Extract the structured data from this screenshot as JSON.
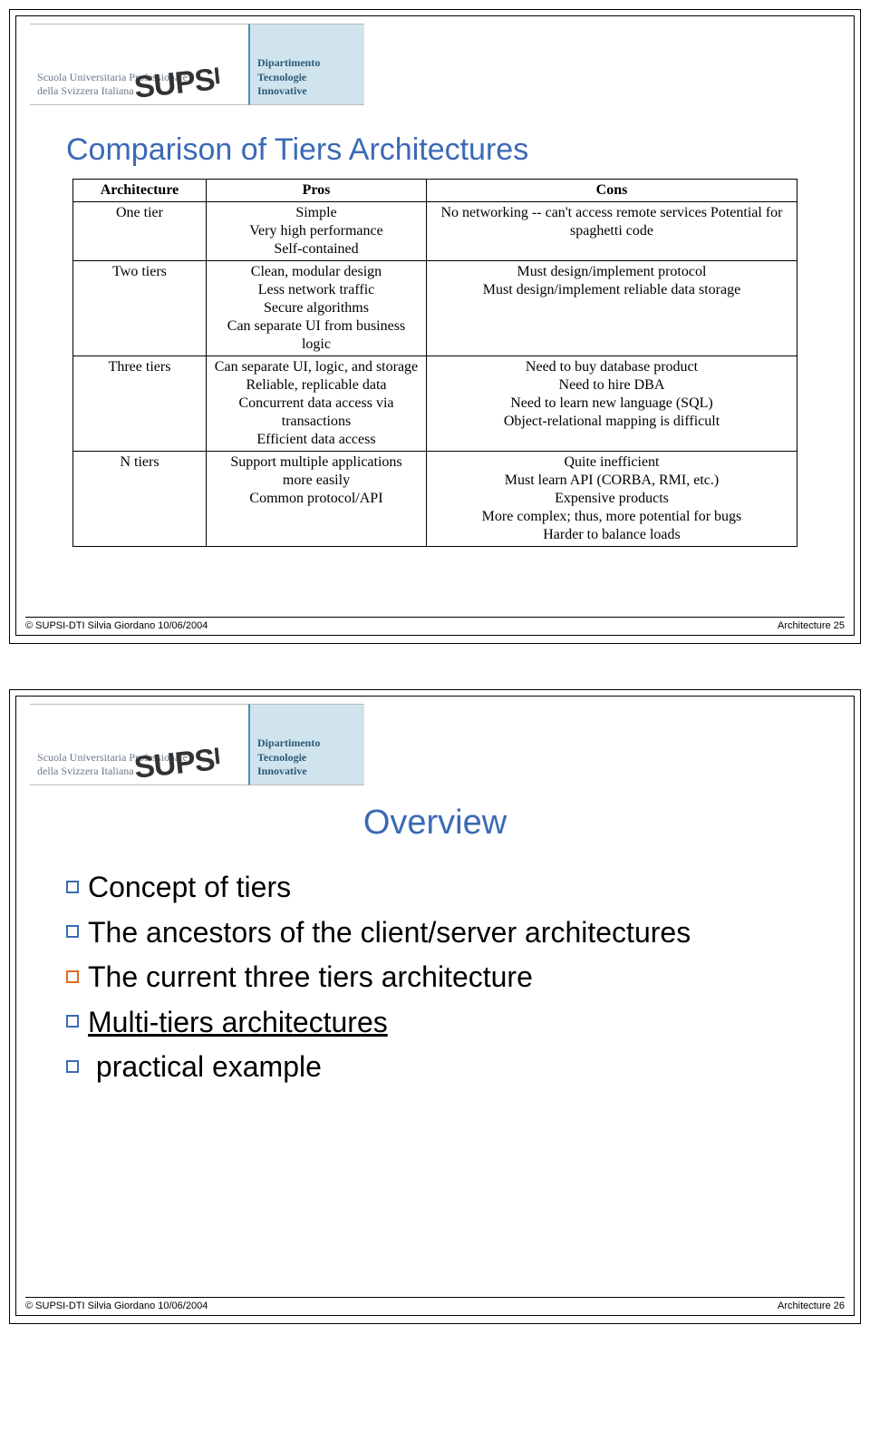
{
  "logo": {
    "left_line1": "Scuola Universitaria Professionale",
    "left_line2": "della Svizzera Italiana",
    "right_line1": "Dipartimento",
    "right_line2": "Tecnologie",
    "right_line3": "Innovative",
    "wordmark": "SUPSI"
  },
  "slide1": {
    "title": "Comparison of Tiers Architectures",
    "headers": {
      "c0": "Architecture",
      "c1": "Pros",
      "c2": "Cons"
    },
    "rows": [
      {
        "arch": "One tier",
        "pros": "Simple\nVery high performance\nSelf-contained",
        "cons": "No networking -- can't access remote services Potential for spaghetti code"
      },
      {
        "arch": "Two tiers",
        "pros": "Clean, modular design\nLess network traffic\nSecure algorithms\nCan separate UI from business logic",
        "cons": "Must design/implement protocol\nMust design/implement reliable data storage"
      },
      {
        "arch": "Three tiers",
        "pros": "Can separate UI, logic, and storage\nReliable, replicable data\nConcurrent data access via transactions\nEfficient data access",
        "cons": "Need to buy database product\nNeed to hire DBA\nNeed to learn new language (SQL)\nObject-relational mapping is difficult"
      },
      {
        "arch": "N tiers",
        "pros": "Support multiple applications more easily\nCommon protocol/API",
        "cons": "Quite inefficient\nMust learn API (CORBA, RMI, etc.)\nExpensive products\nMore complex; thus, more potential for bugs\nHarder to balance loads"
      }
    ],
    "footer_left": "© SUPSI-DTI    Silvia Giordano    10/06/2004",
    "footer_right": "Architecture  25"
  },
  "slide2": {
    "title": "Overview",
    "items": [
      {
        "text": "Concept of tiers",
        "color": "blue",
        "underline": false
      },
      {
        "text": "The ancestors of the client/server architectures",
        "color": "blue",
        "underline": false
      },
      {
        "text": "The current three tiers architecture",
        "color": "orange",
        "underline": false
      },
      {
        "text": "Multi-tiers architectures",
        "color": "blue",
        "underline": true
      },
      {
        "text": " practical example",
        "color": "blue",
        "underline": false
      }
    ],
    "footer_left": "© SUPSI-DTI    Silvia Giordano    10/06/2004",
    "footer_right": "Architecture  26"
  }
}
